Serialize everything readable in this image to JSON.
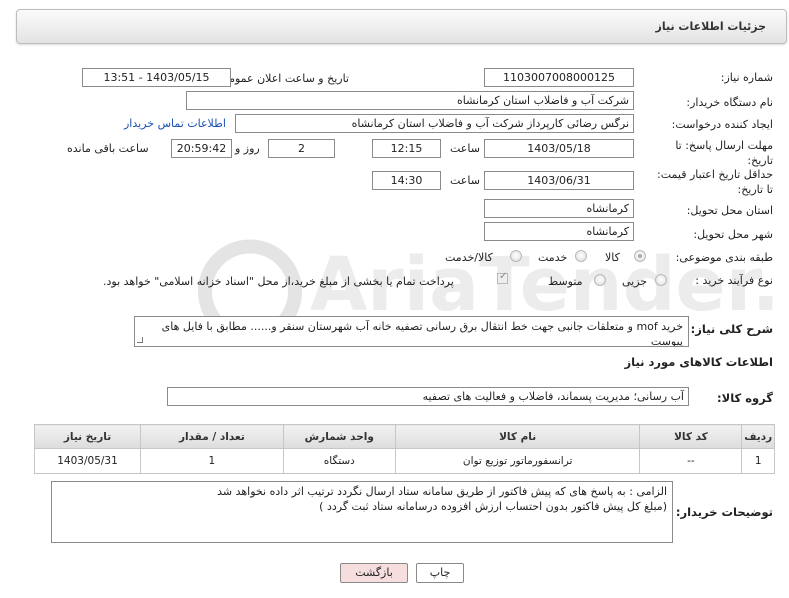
{
  "header": {
    "title": "جزئیات اطلاعات نیاز"
  },
  "form": {
    "need_number_label": "شماره نیاز:",
    "need_number": "1103007008000125",
    "announce_label": "تاریخ و ساعت اعلان عمومی:",
    "announce_value": "1403/05/15 - 13:51",
    "buyer_org_label": "نام دستگاه خریدار:",
    "buyer_org": "شرکت آب و فاضلاب استان کرمانشاه",
    "requester_label": "ایجاد کننده درخواست:",
    "requester": "نرگس رضائی کارپرداز شرکت آب و فاضلاب استان کرمانشاه",
    "buyer_contact_link": "اطلاعات تماس خریدار",
    "reply_deadline_label": "مهلت ارسال پاسخ: تا تاریخ:",
    "reply_date": "1403/05/18",
    "time_label": "ساعت",
    "reply_time": "12:15",
    "days_value": "2",
    "days_label": "روز و",
    "remaining_time": "20:59:42",
    "remaining_label": "ساعت باقی مانده",
    "price_validity_label": "حداقل تاریخ اعتبار قیمت: تا تاریخ:",
    "validity_date": "1403/06/31",
    "validity_time_label": "ساعت",
    "validity_time": "14:30",
    "province_label": "استان محل تحویل:",
    "province": "کرمانشاه",
    "city_label": "شهر محل تحویل:",
    "city": "کرمانشاه",
    "category_label": "طبقه بندی موضوعی:",
    "category_options": [
      "کالا",
      "خدمت",
      "کالا/خدمت"
    ],
    "purchase_type_label": "نوع فرآیند خرید :",
    "purchase_options": [
      "جزیی",
      "متوسط"
    ],
    "payment_note": "پرداخت تمام یا بخشی از مبلغ خرید،از محل \"اسناد خزانه اسلامی\" خواهد بود."
  },
  "description": {
    "label": "شرح کلی نیاز:",
    "text": "خرید mof و متعلقات جانبی جهت خط انتقال برق رسانی تصفیه خانه آب شهرستان سنقر و...... مطابق با فایل های پیوست"
  },
  "goods_section": {
    "title": "اطلاعات کالاهای مورد نیاز",
    "group_label": "گروه کالا:",
    "group_value": "آب رسانی؛ مدیریت پسماند، فاضلاب و فعالیت های تصفیه"
  },
  "table": {
    "headers": [
      "ردیف",
      "کد کالا",
      "نام کالا",
      "واحد شمارش",
      "تعداد / مقدار",
      "تاریخ نیاز"
    ],
    "rows": [
      [
        "1",
        "--",
        "ترانسفورماتور توزیع توان",
        "دستگاه",
        "1",
        "1403/05/31"
      ]
    ]
  },
  "buyer_notes": {
    "label": "توضیحات خریدار:",
    "line1": "الزامی : به پاسخ های که پیش فاکتور از طریق سامانه ستاد ارسال نگردد ترتیب اثر داده نخواهد شد",
    "line2": "(مبلغ کل پیش فاکتور بدون احتساب ارزش افزوده درسامانه ستاد ثبت گردد )"
  },
  "buttons": {
    "print": "چاپ",
    "back": "بازگشت"
  },
  "colors": {
    "back_button": "#f7dede",
    "link": "#1a4fb5",
    "watermark": "#e9e9e9"
  }
}
